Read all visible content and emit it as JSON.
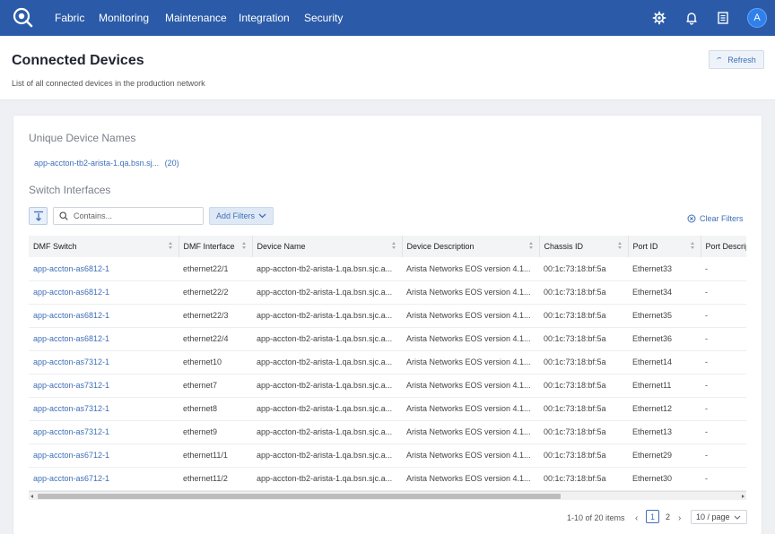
{
  "nav": {
    "items": [
      {
        "label": "Fabric"
      },
      {
        "label": "Monitoring"
      },
      {
        "label": "Maintenance"
      },
      {
        "label": "Integration"
      },
      {
        "label": "Security"
      }
    ],
    "avatar_initial": "A",
    "bar_color": "#2b5ba8"
  },
  "header": {
    "title": "Connected Devices",
    "subtitle": "List of all connected devices in the production network",
    "refresh_label": "Refresh"
  },
  "unique_devices": {
    "section_title": "Unique Device Names",
    "name": "app-accton-tb2-arista-1.qa.bsn.sj...",
    "count": "(20)"
  },
  "switch_interfaces": {
    "section_title": "Switch Interfaces",
    "search_placeholder": "Contains...",
    "add_filters_label": "Add Filters",
    "clear_filters_label": "Clear Filters"
  },
  "table": {
    "columns": [
      "DMF Switch",
      "DMF Interface",
      "Device Name",
      "Device Description",
      "Chassis ID",
      "Port ID",
      "Port Description"
    ],
    "rows": [
      [
        "app-accton-as6812-1",
        "ethernet22/1",
        "app-accton-tb2-arista-1.qa.bsn.sjc.a...",
        "Arista Networks EOS version 4.1...",
        "00:1c:73:18:bf:5a",
        "Ethernet33",
        "-"
      ],
      [
        "app-accton-as6812-1",
        "ethernet22/2",
        "app-accton-tb2-arista-1.qa.bsn.sjc.a...",
        "Arista Networks EOS version 4.1...",
        "00:1c:73:18:bf:5a",
        "Ethernet34",
        "-"
      ],
      [
        "app-accton-as6812-1",
        "ethernet22/3",
        "app-accton-tb2-arista-1.qa.bsn.sjc.a...",
        "Arista Networks EOS version 4.1...",
        "00:1c:73:18:bf:5a",
        "Ethernet35",
        "-"
      ],
      [
        "app-accton-as6812-1",
        "ethernet22/4",
        "app-accton-tb2-arista-1.qa.bsn.sjc.a...",
        "Arista Networks EOS version 4.1...",
        "00:1c:73:18:bf:5a",
        "Ethernet36",
        "-"
      ],
      [
        "app-accton-as7312-1",
        "ethernet10",
        "app-accton-tb2-arista-1.qa.bsn.sjc.a...",
        "Arista Networks EOS version 4.1...",
        "00:1c:73:18:bf:5a",
        "Ethernet14",
        "-"
      ],
      [
        "app-accton-as7312-1",
        "ethernet7",
        "app-accton-tb2-arista-1.qa.bsn.sjc.a...",
        "Arista Networks EOS version 4.1...",
        "00:1c:73:18:bf:5a",
        "Ethernet11",
        "-"
      ],
      [
        "app-accton-as7312-1",
        "ethernet8",
        "app-accton-tb2-arista-1.qa.bsn.sjc.a...",
        "Arista Networks EOS version 4.1...",
        "00:1c:73:18:bf:5a",
        "Ethernet12",
        "-"
      ],
      [
        "app-accton-as7312-1",
        "ethernet9",
        "app-accton-tb2-arista-1.qa.bsn.sjc.a...",
        "Arista Networks EOS version 4.1...",
        "00:1c:73:18:bf:5a",
        "Ethernet13",
        "-"
      ],
      [
        "app-accton-as6712-1",
        "ethernet11/1",
        "app-accton-tb2-arista-1.qa.bsn.sjc.a...",
        "Arista Networks EOS version 4.1...",
        "00:1c:73:18:bf:5a",
        "Ethernet29",
        "-"
      ],
      [
        "app-accton-as6712-1",
        "ethernet11/2",
        "app-accton-tb2-arista-1.qa.bsn.sjc.a...",
        "Arista Networks EOS version 4.1...",
        "00:1c:73:18:bf:5a",
        "Ethernet30",
        "-"
      ]
    ]
  },
  "pagination": {
    "summary": "1-10 of 20 items",
    "pages": [
      "1",
      "2"
    ],
    "current_page": "1",
    "page_size": "10 / page"
  }
}
